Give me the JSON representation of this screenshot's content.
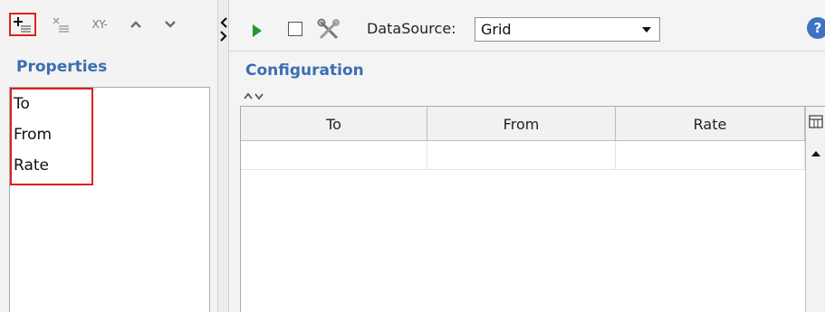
{
  "left_toolbar": {
    "add_icon": "add-row-icon",
    "remove_icon": "remove-row-icon",
    "xy_label": "XY-",
    "up_icon": "chevron-up-icon",
    "down_icon": "chevron-down-icon"
  },
  "properties": {
    "title": "Properties",
    "items": [
      "To",
      "From",
      "Rate"
    ]
  },
  "toolbar": {
    "run_icon": "play-icon",
    "stop_icon": "stop-icon",
    "tools_icon": "tools-icon",
    "datasource_label": "DataSource:",
    "datasource_value": "Grid",
    "help_glyph": "?"
  },
  "configuration": {
    "title": "Configuration",
    "columns": [
      "To",
      "From",
      "Rate"
    ],
    "rows": [
      [
        "",
        "",
        ""
      ]
    ]
  },
  "colors": {
    "accent": "#3b6db0",
    "highlight": "#e02020",
    "play": "#1e9a2e"
  }
}
